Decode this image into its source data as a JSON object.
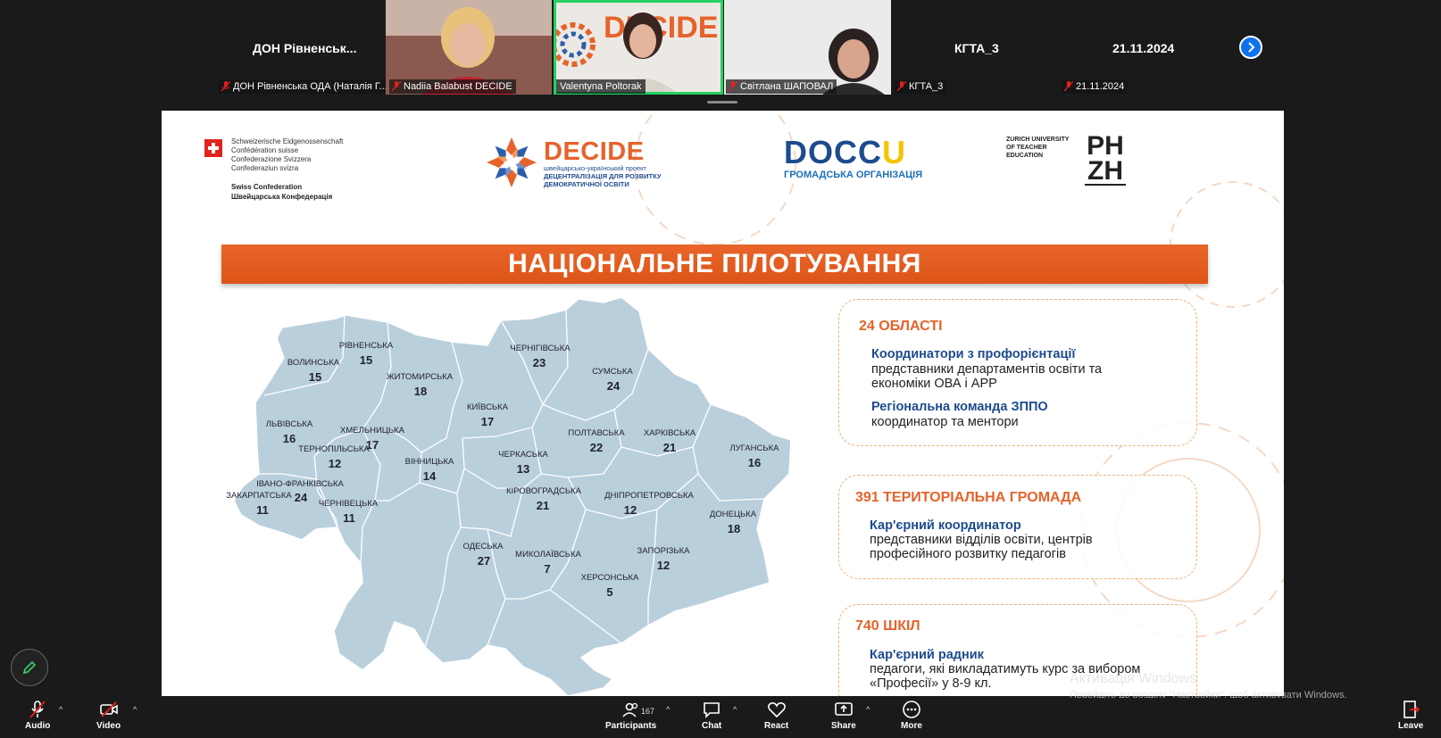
{
  "top_strip": {
    "tiles": [
      {
        "name": "ДОН Рівненськ...",
        "label": "ДОН Рівненська ОДА (Наталія Г..."
      },
      {
        "label": "Nadiia Balabust DECIDE"
      },
      {
        "label": "Valentyna Poltorak"
      },
      {
        "label": "Світлана ШАПОВАЛ"
      },
      {
        "name": "КГТА_3",
        "label": "КГТА_3"
      },
      {
        "name": "21.11.2024",
        "label": "21.11.2024"
      }
    ],
    "video_logo_text": "DECIDE"
  },
  "slide": {
    "swiss": {
      "lines": [
        "Schweizerische Eidgenossenschaft",
        "Confédération suisse",
        "Confederazione Svizzera",
        "Confederaziun svizra"
      ],
      "bottom": [
        "Swiss Confederation",
        "Швейцарська Конфедерація"
      ]
    },
    "decide": {
      "title": "DECIDE",
      "sub1": "швейцарсько-український проект",
      "sub2": "ДЕЦЕНТРАЛІЗАЦІЯ ДЛЯ РОЗВИТКУ",
      "sub3": "ДЕМОКРАТИЧНОЇ ОСВІТИ"
    },
    "doccu": {
      "title_a": "DOCC",
      "title_b": "U",
      "sub": "ГРОМАДСЬКА ОРГАНІЗАЦІЯ"
    },
    "zurich": [
      "ZURICH UNIVERSITY",
      "OF TEACHER",
      "EDUCATION"
    ],
    "phzh": [
      "PH",
      "ZH"
    ],
    "banner": "НАЦІОНАЛЬНЕ ПІЛОТУВАННЯ",
    "map_regions": [
      {
        "name": "ВОЛИНСЬКА",
        "value": "15"
      },
      {
        "name": "РІВНЕНСЬКА",
        "value": "15"
      },
      {
        "name": "ЖИТОМИРСЬКА",
        "value": "18"
      },
      {
        "name": "ЧЕРНІГІВСЬКА",
        "value": "23"
      },
      {
        "name": "СУМСЬКА",
        "value": "24"
      },
      {
        "name": "КИЇВСЬКА",
        "value": "17"
      },
      {
        "name": "ЛЬВІВСЬКА",
        "value": "16"
      },
      {
        "name": "ХМЕЛЬНИЦЬКА",
        "value": "17"
      },
      {
        "name": "ТЕРНОПІЛЬСЬКА",
        "value": "12"
      },
      {
        "name": "ВІННИЦЬКА",
        "value": "14"
      },
      {
        "name": "ЧЕРКАСЬКА",
        "value": "13"
      },
      {
        "name": "ПОЛТАВСЬКА",
        "value": "22"
      },
      {
        "name": "ХАРКІВСЬКА",
        "value": "21"
      },
      {
        "name": "ЛУГАНСЬКА",
        "value": "16"
      },
      {
        "name": "ІВАНО-ФРАНКІВСЬКА",
        "value": "24"
      },
      {
        "name": "ЗАКАРПАТСЬКА",
        "value": "11"
      },
      {
        "name": "ЧЕРНІВЕЦЬКА",
        "value": "11"
      },
      {
        "name": "КІРОВОГРАДСЬКА",
        "value": "21"
      },
      {
        "name": "ДНІПРОПЕТРОВСЬКА",
        "value": "12"
      },
      {
        "name": "ДОНЕЦЬКА",
        "value": "18"
      },
      {
        "name": "ОДЕСЬКА",
        "value": "27"
      },
      {
        "name": "МИКОЛАЇВСЬКА",
        "value": "7"
      },
      {
        "name": "ЗАПОРІЗЬКА",
        "value": "12"
      },
      {
        "name": "ХЕРСОНСЬКА",
        "value": "5"
      }
    ],
    "boxes": [
      {
        "head": "24 ОБЛАСТІ",
        "role1": "Координатори з профорієнтації",
        "text1a": "представники департаментів освіти та",
        "text1b": "економіки ОВА і АРР",
        "role2": "Регіональна команда ЗППО",
        "text2a": "координатор та ментори"
      },
      {
        "head": "391 ТЕРИТОРІАЛЬНА ГРОМАДА",
        "role1": "Кар'єрний координатор",
        "text1a": "представники відділів освіти, центрів",
        "text1b": "професійного розвитку педагогів"
      },
      {
        "head": "740 ШКІЛ",
        "role1": "Кар'єрний радник",
        "text1a": "педагоги, які викладатимуть курс за вибором",
        "text1b": "«Професії» у 8-9 кл."
      }
    ]
  },
  "watermark": {
    "title": "Активація Windows",
    "sub": "Перейдіть до розділу \"Настройки\", щоб активувати Windows."
  },
  "toolbar": {
    "audio": "Audio",
    "video": "Video",
    "participants": "Participants",
    "participants_count": "167",
    "chat": "Chat",
    "react": "React",
    "share": "Share",
    "more": "More",
    "leave": "Leave"
  },
  "colors": {
    "accent_orange": "#e5632b",
    "brand_blue": "#1e4b8e",
    "map_fill": "#b9cfdc",
    "zoom_blue": "#0e72ed",
    "active_green": "#23d160"
  }
}
